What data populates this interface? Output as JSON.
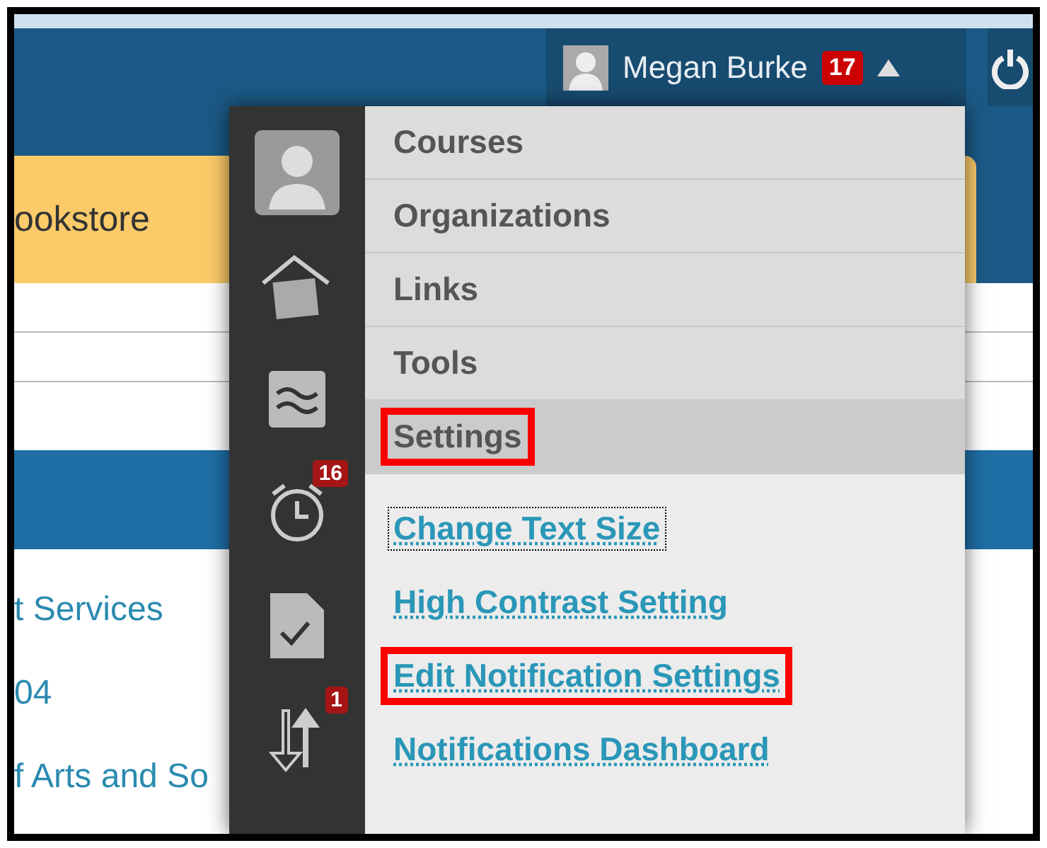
{
  "header": {
    "user_name": "Megan Burke",
    "notification_count": "17"
  },
  "background": {
    "tab_label": "ookstore",
    "links": [
      "t Services",
      "04",
      "f Arts and So"
    ]
  },
  "menu": {
    "icons": [
      {
        "kind": "avatar"
      },
      {
        "kind": "home"
      },
      {
        "kind": "stream"
      },
      {
        "kind": "clock",
        "badge": "16"
      },
      {
        "kind": "grade"
      },
      {
        "kind": "arrows",
        "badge": "1"
      }
    ],
    "items": [
      {
        "label": "Courses",
        "selected": false,
        "highlighted": false
      },
      {
        "label": "Organizations",
        "selected": false,
        "highlighted": false
      },
      {
        "label": "Links",
        "selected": false,
        "highlighted": false
      },
      {
        "label": "Tools",
        "selected": false,
        "highlighted": false
      },
      {
        "label": "Settings",
        "selected": true,
        "highlighted": true
      }
    ],
    "sub_links": [
      {
        "label": "Change Text Size",
        "focused": true,
        "highlighted": false
      },
      {
        "label": "High Contrast Setting",
        "focused": false,
        "highlighted": false
      },
      {
        "label": "Edit Notification Settings",
        "focused": false,
        "highlighted": true
      },
      {
        "label": "Notifications Dashboard",
        "focused": false,
        "highlighted": false
      }
    ]
  }
}
